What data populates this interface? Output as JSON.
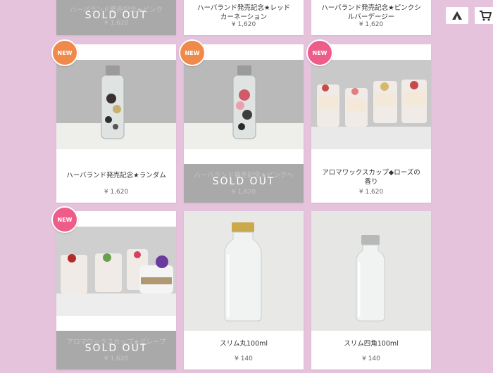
{
  "badge_label": "NEW",
  "sold_out_label": "SOLD OUT",
  "header_icons": [
    "tent-icon",
    "cart-icon"
  ],
  "products": [
    {
      "title": "ハーバランド発売記念★ピンク",
      "price": "¥ 1,620",
      "sold_out": true
    },
    {
      "title": "ハーバランド発売記念★レッドカーネーション",
      "title_lines": [
        "ハーバランド発売記念★レッド",
        "カーネーション"
      ],
      "price": "¥ 1,620"
    },
    {
      "title": "ハーバランド発売記念★ピンクシルバーデージー",
      "title_lines": [
        "ハーバランド発売記念★ピンクシ",
        "ルバーデージー"
      ],
      "price": "¥ 1,620"
    },
    {
      "title": "ハーバランド発売記念★ランダム",
      "price": "¥ 1,620",
      "badge": true
    },
    {
      "title": "ハーバランド発売記念★ピンクヘ",
      "price": "¥ 1,620",
      "badge": true,
      "sold_out": true
    },
    {
      "title": "アロマワックスカップ◆ローズの香り",
      "title_lines": [
        "アロマワックスカップ◆ローズの",
        "香り"
      ],
      "price": "¥ 1,620",
      "badge": true
    },
    {
      "title": "アロマワックスカップ★グレープ",
      "price": "¥ 1,620",
      "badge": true,
      "sold_out": true
    },
    {
      "title": "スリム丸100ml",
      "price": "¥ 140"
    },
    {
      "title": "スリム四角100ml",
      "price": "¥ 140"
    }
  ],
  "colors": {
    "background": "#e6c3dc",
    "sold_out_overlay": "#a9a9a9",
    "badge_orange": "#f08a4b",
    "badge_pink": "#ee5d8a"
  }
}
